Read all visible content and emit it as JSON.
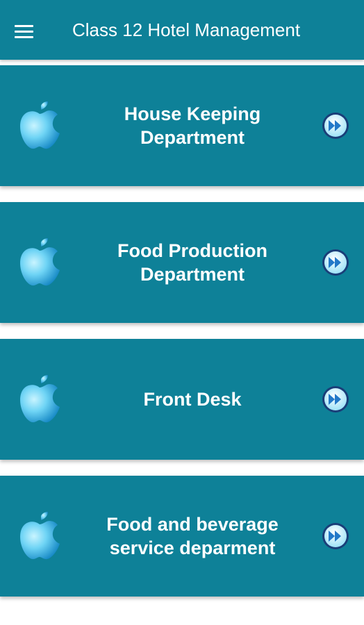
{
  "appbar": {
    "title": "Class 12 Hotel Management",
    "menu_icon": "hamburger-menu-icon"
  },
  "items": [
    {
      "lines": [
        "House Keeping",
        "Department"
      ],
      "icon": "apple-icon",
      "action_icon": "fast-forward-icon"
    },
    {
      "lines": [
        "Food Production",
        "Department"
      ],
      "icon": "apple-icon",
      "action_icon": "fast-forward-icon"
    },
    {
      "lines": [
        "Front Desk"
      ],
      "icon": "apple-icon",
      "action_icon": "fast-forward-icon"
    },
    {
      "lines": [
        "Food and beverage",
        "service deparment"
      ],
      "icon": "apple-icon",
      "action_icon": "fast-forward-icon"
    }
  ],
  "colors": {
    "appbar": "#0e8198",
    "card": "#0e8198",
    "apple_light": "#8fe6ff",
    "apple_dark": "#1aa3d6",
    "button_ring": "#1a3e78"
  }
}
